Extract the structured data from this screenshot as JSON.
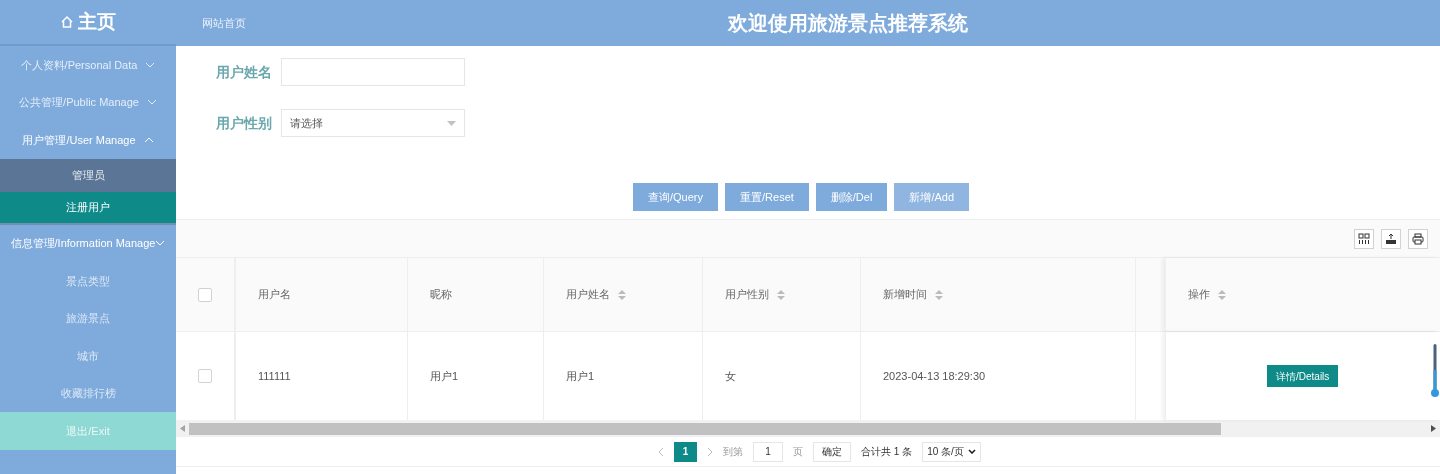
{
  "header": {
    "home_label": "主页",
    "site_link": "网站首页",
    "title": "欢迎使用旅游景点推荐系统"
  },
  "sidebar": {
    "items": [
      {
        "label": "个人资料/Personal Data",
        "expanded": false
      },
      {
        "label": "公共管理/Public Manage",
        "expanded": false
      },
      {
        "label": "用户管理/User Manage",
        "expanded": true,
        "children": [
          {
            "label": "管理员",
            "selected": false,
            "hovered": true
          },
          {
            "label": "注册用户",
            "selected": true,
            "hovered": false
          }
        ]
      },
      {
        "label": "信息管理/Information Manage",
        "expanded": true,
        "children": [
          {
            "label": "景点类型",
            "selected": false,
            "hovered": false
          },
          {
            "label": "旅游景点",
            "selected": false,
            "hovered": false
          },
          {
            "label": "城市",
            "selected": false,
            "hovered": false
          },
          {
            "label": "收藏排行榜",
            "selected": false,
            "hovered": false
          }
        ]
      }
    ],
    "exit": "退出/Exit"
  },
  "search": {
    "fields": [
      {
        "label": "用户姓名",
        "kind": "text"
      },
      {
        "label": "用户性别",
        "kind": "select",
        "placeholder": "请选择"
      }
    ],
    "buttons": [
      {
        "label": "查询/Query",
        "hovered": false
      },
      {
        "label": "重置/Reset",
        "hovered": false
      },
      {
        "label": "删除/Del",
        "hovered": false
      },
      {
        "label": "新增/Add",
        "hovered": true
      }
    ]
  },
  "table": {
    "header_checked": false,
    "columns": [
      {
        "label": "用户名",
        "sortable": false
      },
      {
        "label": "昵称",
        "sortable": false
      },
      {
        "label": "用户姓名",
        "sortable": true
      },
      {
        "label": "用户性别",
        "sortable": true
      },
      {
        "label": "新增时间",
        "sortable": true
      }
    ],
    "action_column": {
      "label": "操作",
      "sortable": true
    },
    "rows": [
      {
        "checked": false,
        "cells": [
          "111111",
          "用户1",
          "用户1",
          "女",
          "2023-04-13 18:29:30"
        ],
        "action": "详情/Details"
      }
    ]
  },
  "pagination": {
    "pages": [
      {
        "label": "1",
        "selected": true
      }
    ],
    "goto_label": "到第",
    "goto_value": "1",
    "page_unit": "页",
    "confirm": "确定",
    "total": "合计共 1 条",
    "page_size": "10 条/页"
  }
}
